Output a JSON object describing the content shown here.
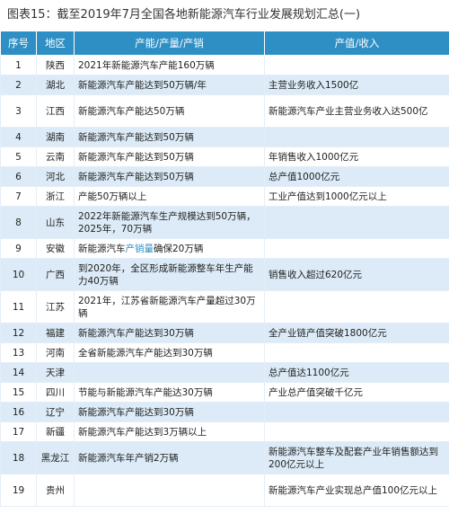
{
  "title": "图表15：截至2019年7月全国各地新能源汽车行业发展规划汇总(一)",
  "headers": {
    "index": "序号",
    "region": "地区",
    "capacity": "产能/产量/产销",
    "value": "产值/收入"
  },
  "rows": [
    {
      "index": "1",
      "region": "陕西",
      "capacity": "2021年新能源汽车产能160万辆",
      "value": ""
    },
    {
      "index": "2",
      "region": "湖北",
      "capacity": "新能源汽车产能达到50万辆/年",
      "value": "主营业务收入1500亿"
    },
    {
      "index": "3",
      "region": "江西",
      "capacity": "新能源汽车产能达50万辆",
      "value": "新能源汽车产业主营业务收入达500亿"
    },
    {
      "index": "4",
      "region": "湖南",
      "capacity": "新能源汽车产能达到50万辆",
      "value": ""
    },
    {
      "index": "5",
      "region": "云南",
      "capacity": "新能源汽车产能达到50万辆",
      "value": "年销售收入1000亿元"
    },
    {
      "index": "6",
      "region": "河北",
      "capacity": "新能源汽车产能达到50万辆",
      "value": "总产值1000亿元"
    },
    {
      "index": "7",
      "region": "浙江",
      "capacity": "产能50万辆以上",
      "value": "工业产值达到1000亿元以上"
    },
    {
      "index": "8",
      "region": "山东",
      "capacity": "2022年新能源汽车生产规模达到50万辆，2025年，70万辆",
      "value": ""
    },
    {
      "index": "9",
      "region": "安徽",
      "capacity_pre": "新能源汽车",
      "capacity_hl": "产销量",
      "capacity_post": "确保20万辆",
      "value": ""
    },
    {
      "index": "10",
      "region": "广西",
      "capacity": "到2020年，全区形成新能源整车年生产能力40万辆",
      "value": "销售收入超过620亿元"
    },
    {
      "index": "11",
      "region": "江苏",
      "capacity": "2021年，江苏省新能源汽车产量超过30万辆",
      "value": ""
    },
    {
      "index": "12",
      "region": "福建",
      "capacity": "新能源汽车产能达到30万辆",
      "value": "全产业链产值突破1800亿元"
    },
    {
      "index": "13",
      "region": "河南",
      "capacity": "全省新能源汽车产能达到30万辆",
      "value": ""
    },
    {
      "index": "14",
      "region": "天津",
      "capacity": "",
      "value": "总产值达1100亿元"
    },
    {
      "index": "15",
      "region": "四川",
      "capacity": "节能与新能源汽车产能达30万辆",
      "value": "产业总产值突破千亿元"
    },
    {
      "index": "16",
      "region": "辽宁",
      "capacity": "新能源汽车产能达到30万辆",
      "value": ""
    },
    {
      "index": "17",
      "region": "新疆",
      "capacity": "新能源汽车产能达到3万辆以上",
      "value": ""
    },
    {
      "index": "18",
      "region": "黑龙江",
      "capacity": "新能源汽车年产销2万辆",
      "value": "新能源汽车整车及配套产业年销售额达到200亿元以上"
    },
    {
      "index": "19",
      "region": "贵州",
      "capacity": "",
      "value": "新能源汽车产业实现总产值100亿元以上"
    }
  ]
}
